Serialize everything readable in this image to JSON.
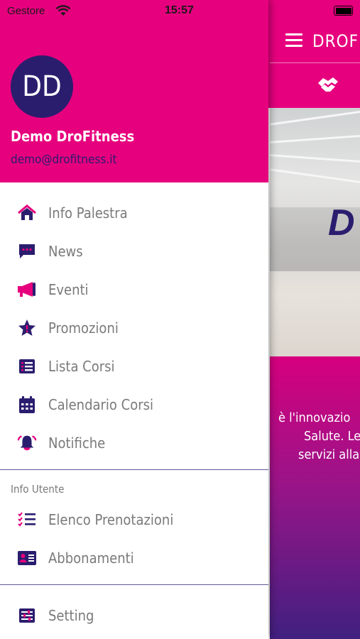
{
  "status_bar": {
    "carrier": "Gestore",
    "time": "15:57"
  },
  "drawer": {
    "avatar_initials": "DD",
    "user_name": "Demo DroFitness",
    "user_email": "demo@drofitness.it",
    "menu": [
      {
        "label": "Info Palestra",
        "icon": "home-icon"
      },
      {
        "label": "News",
        "icon": "chat-icon"
      },
      {
        "label": "Eventi",
        "icon": "megaphone-icon"
      },
      {
        "label": "Promozioni",
        "icon": "star-icon"
      },
      {
        "label": "Lista Corsi",
        "icon": "list-icon"
      },
      {
        "label": "Calendario Corsi",
        "icon": "calendar-icon"
      },
      {
        "label": "Notifiche",
        "icon": "bell-icon"
      }
    ],
    "section_user": "Info Utente",
    "user_menu": [
      {
        "label": "Elenco Prenotazioni",
        "icon": "checklist-icon"
      },
      {
        "label": "Abbonamenti",
        "icon": "id-card-icon"
      }
    ],
    "settings": {
      "label": "Setting",
      "icon": "settings-icon"
    }
  },
  "background": {
    "title": "DROFIT",
    "logo_text": "D",
    "text_lines": [
      "è l'innovazio",
      "Salute. Le",
      "servizi alla"
    ]
  },
  "colors": {
    "primary": "#e6007e",
    "secondary": "#2b1d6e",
    "menu_text": "#7a7a7a"
  }
}
